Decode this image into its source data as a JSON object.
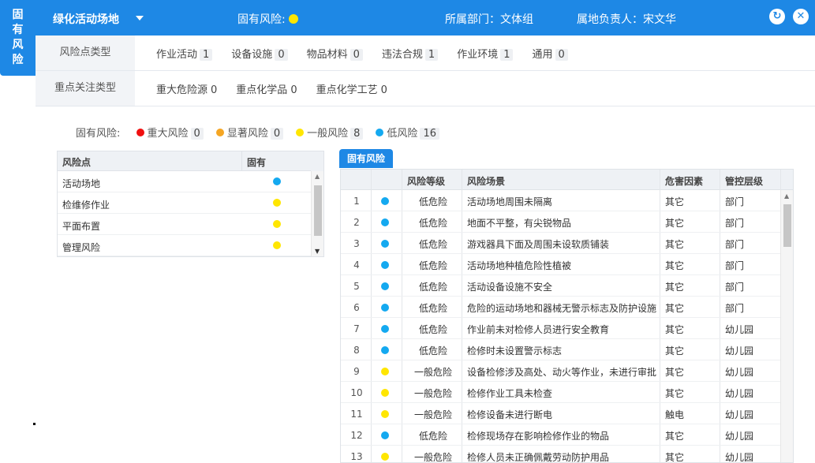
{
  "side_tab": {
    "chars": [
      "固",
      "有",
      "风",
      "险"
    ]
  },
  "header": {
    "title": "绿化活动场地",
    "risk_label": "固有风险:",
    "risk_color": "#ffe600",
    "dept": "所属部门：文体组",
    "owner": "属地负责人：宋文华",
    "refresh_icon": "refresh-icon",
    "close_icon": "close-icon"
  },
  "filter_risk_type": {
    "label": "风险点类型",
    "items": [
      {
        "name": "作业活动",
        "count": "1"
      },
      {
        "name": "设备设施",
        "count": "0"
      },
      {
        "name": "物品材料",
        "count": "0"
      },
      {
        "name": "违法合规",
        "count": "1"
      },
      {
        "name": "作业环境",
        "count": "1"
      },
      {
        "name": "通用",
        "count": "0"
      }
    ]
  },
  "filter_focus_type": {
    "label": "重点关注类型",
    "items": [
      {
        "name": "重大危险源",
        "count": "0"
      },
      {
        "name": "重点化学品",
        "count": "0"
      },
      {
        "name": "重点化学工艺",
        "count": "0"
      }
    ]
  },
  "legend": {
    "label": "固有风险:",
    "items": [
      {
        "name": "重大风险",
        "count": "0",
        "color": "#f01010"
      },
      {
        "name": "显著风险",
        "count": "0",
        "color": "#f5a623"
      },
      {
        "name": "一般风险",
        "count": "8",
        "color": "#ffe600"
      },
      {
        "name": "低风险",
        "count": "16",
        "color": "#14a9f0"
      }
    ]
  },
  "left_table": {
    "headers": {
      "point": "风险点",
      "inherent": "固有"
    },
    "rows": [
      {
        "name": "活动场地",
        "color": "#14a9f0"
      },
      {
        "name": "检维修作业",
        "color": "#ffe600"
      },
      {
        "name": "平面布置",
        "color": "#ffe600"
      },
      {
        "name": "管理风险",
        "color": "#ffe600"
      }
    ]
  },
  "right_panel": {
    "tab": "固有风险",
    "headers": {
      "level": "风险等级",
      "scene": "风险场景",
      "hazard": "危害因素",
      "control": "管控层级"
    },
    "rows": [
      {
        "idx": "1",
        "color": "#14a9f0",
        "level": "低危险",
        "scene": "活动场地周围未隔离",
        "hazard": "其它",
        "control": "部门"
      },
      {
        "idx": "2",
        "color": "#14a9f0",
        "level": "低危险",
        "scene": "地面不平整，有尖锐物品",
        "hazard": "其它",
        "control": "部门"
      },
      {
        "idx": "3",
        "color": "#14a9f0",
        "level": "低危险",
        "scene": "游戏器具下面及周围未设软质铺装",
        "hazard": "其它",
        "control": "部门"
      },
      {
        "idx": "4",
        "color": "#14a9f0",
        "level": "低危险",
        "scene": "活动场地种植危险性植被",
        "hazard": "其它",
        "control": "部门"
      },
      {
        "idx": "5",
        "color": "#14a9f0",
        "level": "低危险",
        "scene": "活动设备设施不安全",
        "hazard": "其它",
        "control": "部门"
      },
      {
        "idx": "6",
        "color": "#14a9f0",
        "level": "低危险",
        "scene": "危险的运动场地和器械无警示标志及防护设施",
        "hazard": "其它",
        "control": "部门"
      },
      {
        "idx": "7",
        "color": "#14a9f0",
        "level": "低危险",
        "scene": "作业前未对检修人员进行安全教育",
        "hazard": "其它",
        "control": "幼儿园"
      },
      {
        "idx": "8",
        "color": "#14a9f0",
        "level": "低危险",
        "scene": "检修时未设置警示标志",
        "hazard": "其它",
        "control": "幼儿园"
      },
      {
        "idx": "9",
        "color": "#ffe600",
        "level": "一般危险",
        "scene": "设备检修涉及高处、动火等作业，未进行审批",
        "hazard": "其它",
        "control": "幼儿园"
      },
      {
        "idx": "10",
        "color": "#ffe600",
        "level": "一般危险",
        "scene": "检修作业工具未检查",
        "hazard": "其它",
        "control": "幼儿园"
      },
      {
        "idx": "11",
        "color": "#ffe600",
        "level": "一般危险",
        "scene": "检修设备未进行断电",
        "hazard": "触电",
        "control": "幼儿园"
      },
      {
        "idx": "12",
        "color": "#14a9f0",
        "level": "低危险",
        "scene": "检修现场存在影响检修作业的物品",
        "hazard": "其它",
        "control": "幼儿园"
      },
      {
        "idx": "13",
        "color": "#ffe600",
        "level": "一般危险",
        "scene": "检修人员未正确佩戴劳动防护用品",
        "hazard": "其它",
        "control": "幼儿园"
      }
    ]
  }
}
